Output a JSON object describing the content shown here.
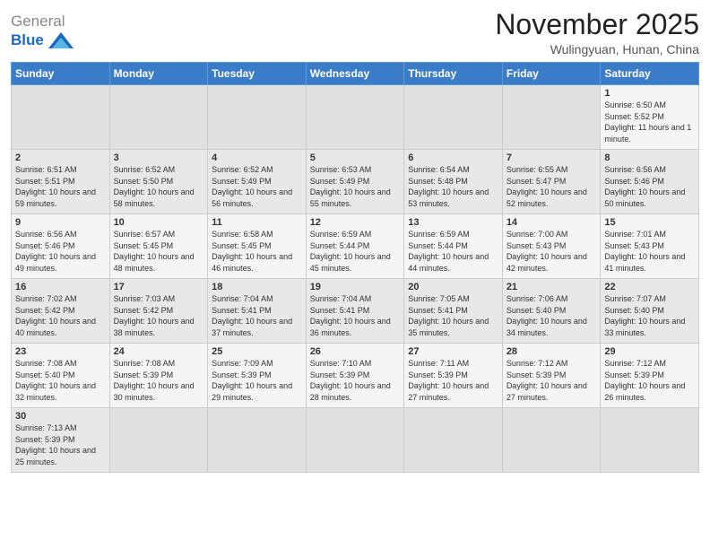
{
  "logo": {
    "text_general": "General",
    "text_blue": "Blue"
  },
  "header": {
    "month_title": "November 2025",
    "location": "Wulingyuan, Hunan, China"
  },
  "weekdays": [
    "Sunday",
    "Monday",
    "Tuesday",
    "Wednesday",
    "Thursday",
    "Friday",
    "Saturday"
  ],
  "weeks": [
    [
      {
        "day": "",
        "info": ""
      },
      {
        "day": "",
        "info": ""
      },
      {
        "day": "",
        "info": ""
      },
      {
        "day": "",
        "info": ""
      },
      {
        "day": "",
        "info": ""
      },
      {
        "day": "",
        "info": ""
      },
      {
        "day": "1",
        "info": "Sunrise: 6:50 AM\nSunset: 5:52 PM\nDaylight: 11 hours and 1 minute."
      }
    ],
    [
      {
        "day": "2",
        "info": "Sunrise: 6:51 AM\nSunset: 5:51 PM\nDaylight: 10 hours and 59 minutes."
      },
      {
        "day": "3",
        "info": "Sunrise: 6:52 AM\nSunset: 5:50 PM\nDaylight: 10 hours and 58 minutes."
      },
      {
        "day": "4",
        "info": "Sunrise: 6:52 AM\nSunset: 5:49 PM\nDaylight: 10 hours and 56 minutes."
      },
      {
        "day": "5",
        "info": "Sunrise: 6:53 AM\nSunset: 5:49 PM\nDaylight: 10 hours and 55 minutes."
      },
      {
        "day": "6",
        "info": "Sunrise: 6:54 AM\nSunset: 5:48 PM\nDaylight: 10 hours and 53 minutes."
      },
      {
        "day": "7",
        "info": "Sunrise: 6:55 AM\nSunset: 5:47 PM\nDaylight: 10 hours and 52 minutes."
      },
      {
        "day": "8",
        "info": "Sunrise: 6:56 AM\nSunset: 5:46 PM\nDaylight: 10 hours and 50 minutes."
      }
    ],
    [
      {
        "day": "9",
        "info": "Sunrise: 6:56 AM\nSunset: 5:46 PM\nDaylight: 10 hours and 49 minutes."
      },
      {
        "day": "10",
        "info": "Sunrise: 6:57 AM\nSunset: 5:45 PM\nDaylight: 10 hours and 48 minutes."
      },
      {
        "day": "11",
        "info": "Sunrise: 6:58 AM\nSunset: 5:45 PM\nDaylight: 10 hours and 46 minutes."
      },
      {
        "day": "12",
        "info": "Sunrise: 6:59 AM\nSunset: 5:44 PM\nDaylight: 10 hours and 45 minutes."
      },
      {
        "day": "13",
        "info": "Sunrise: 6:59 AM\nSunset: 5:44 PM\nDaylight: 10 hours and 44 minutes."
      },
      {
        "day": "14",
        "info": "Sunrise: 7:00 AM\nSunset: 5:43 PM\nDaylight: 10 hours and 42 minutes."
      },
      {
        "day": "15",
        "info": "Sunrise: 7:01 AM\nSunset: 5:43 PM\nDaylight: 10 hours and 41 minutes."
      }
    ],
    [
      {
        "day": "16",
        "info": "Sunrise: 7:02 AM\nSunset: 5:42 PM\nDaylight: 10 hours and 40 minutes."
      },
      {
        "day": "17",
        "info": "Sunrise: 7:03 AM\nSunset: 5:42 PM\nDaylight: 10 hours and 38 minutes."
      },
      {
        "day": "18",
        "info": "Sunrise: 7:04 AM\nSunset: 5:41 PM\nDaylight: 10 hours and 37 minutes."
      },
      {
        "day": "19",
        "info": "Sunrise: 7:04 AM\nSunset: 5:41 PM\nDaylight: 10 hours and 36 minutes."
      },
      {
        "day": "20",
        "info": "Sunrise: 7:05 AM\nSunset: 5:41 PM\nDaylight: 10 hours and 35 minutes."
      },
      {
        "day": "21",
        "info": "Sunrise: 7:06 AM\nSunset: 5:40 PM\nDaylight: 10 hours and 34 minutes."
      },
      {
        "day": "22",
        "info": "Sunrise: 7:07 AM\nSunset: 5:40 PM\nDaylight: 10 hours and 33 minutes."
      }
    ],
    [
      {
        "day": "23",
        "info": "Sunrise: 7:08 AM\nSunset: 5:40 PM\nDaylight: 10 hours and 32 minutes."
      },
      {
        "day": "24",
        "info": "Sunrise: 7:08 AM\nSunset: 5:39 PM\nDaylight: 10 hours and 30 minutes."
      },
      {
        "day": "25",
        "info": "Sunrise: 7:09 AM\nSunset: 5:39 PM\nDaylight: 10 hours and 29 minutes."
      },
      {
        "day": "26",
        "info": "Sunrise: 7:10 AM\nSunset: 5:39 PM\nDaylight: 10 hours and 28 minutes."
      },
      {
        "day": "27",
        "info": "Sunrise: 7:11 AM\nSunset: 5:39 PM\nDaylight: 10 hours and 27 minutes."
      },
      {
        "day": "28",
        "info": "Sunrise: 7:12 AM\nSunset: 5:39 PM\nDaylight: 10 hours and 27 minutes."
      },
      {
        "day": "29",
        "info": "Sunrise: 7:12 AM\nSunset: 5:39 PM\nDaylight: 10 hours and 26 minutes."
      }
    ],
    [
      {
        "day": "30",
        "info": "Sunrise: 7:13 AM\nSunset: 5:39 PM\nDaylight: 10 hours and 25 minutes."
      },
      {
        "day": "",
        "info": ""
      },
      {
        "day": "",
        "info": ""
      },
      {
        "day": "",
        "info": ""
      },
      {
        "day": "",
        "info": ""
      },
      {
        "day": "",
        "info": ""
      },
      {
        "day": "",
        "info": ""
      }
    ]
  ]
}
